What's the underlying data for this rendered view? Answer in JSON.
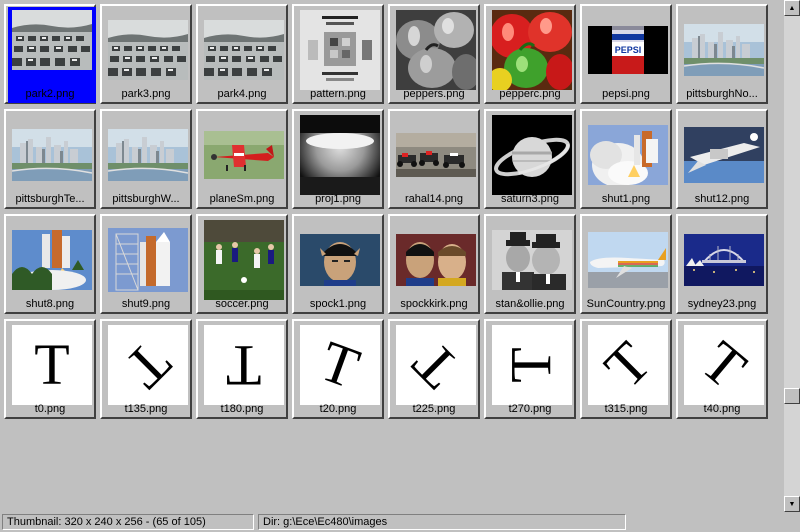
{
  "thumbnails": [
    {
      "label": "park2.png",
      "kind": "parking",
      "selected": true
    },
    {
      "label": "park3.png",
      "kind": "parking"
    },
    {
      "label": "park4.png",
      "kind": "parking"
    },
    {
      "label": "pattern.png",
      "kind": "pattern"
    },
    {
      "label": "peppers.png",
      "kind": "peppers-gray"
    },
    {
      "label": "pepperc.png",
      "kind": "peppers-color"
    },
    {
      "label": "pepsi.png",
      "kind": "pepsi"
    },
    {
      "label": "pittsburghNo...",
      "kind": "city"
    },
    {
      "label": "pittsburghTe...",
      "kind": "city"
    },
    {
      "label": "pittsburghW...",
      "kind": "city"
    },
    {
      "label": "planeSm.png",
      "kind": "plane"
    },
    {
      "label": "proj1.png",
      "kind": "proj"
    },
    {
      "label": "rahal14.png",
      "kind": "race"
    },
    {
      "label": "saturn3.png",
      "kind": "saturn"
    },
    {
      "label": "shut1.png",
      "kind": "shuttle"
    },
    {
      "label": "shut12.png",
      "kind": "shuttle2"
    },
    {
      "label": "shut8.png",
      "kind": "shuttle3"
    },
    {
      "label": "shut9.png",
      "kind": "shuttle4"
    },
    {
      "label": "soccer.png",
      "kind": "soccer"
    },
    {
      "label": "spock1.png",
      "kind": "spock"
    },
    {
      "label": "spockkirk.png",
      "kind": "spockkirk"
    },
    {
      "label": "stan&ollie.png",
      "kind": "stanollie"
    },
    {
      "label": "SunCountry.png",
      "kind": "suncountry"
    },
    {
      "label": "sydney23.png",
      "kind": "sydney"
    },
    {
      "label": "t0.png",
      "kind": "t",
      "rotation": 0
    },
    {
      "label": "t135.png",
      "kind": "t",
      "rotation": 135
    },
    {
      "label": "t180.png",
      "kind": "t",
      "rotation": 180
    },
    {
      "label": "t20.png",
      "kind": "t",
      "rotation": 20
    },
    {
      "label": "t225.png",
      "kind": "t",
      "rotation": 225
    },
    {
      "label": "t270.png",
      "kind": "t",
      "rotation": 270
    },
    {
      "label": "t315.png",
      "kind": "t",
      "rotation": 315
    },
    {
      "label": "t40.png",
      "kind": "t",
      "rotation": 40
    }
  ],
  "t_glyph": "T",
  "scrollbar": {
    "up_icon": "arrow-up-icon",
    "down_icon": "arrow-down-icon"
  },
  "status": {
    "thumbnail_info": "Thumbnail: 320 x 240 x 256 - (65 of 105)",
    "directory": "Dir: g:\\Ece\\Ec480\\images"
  }
}
